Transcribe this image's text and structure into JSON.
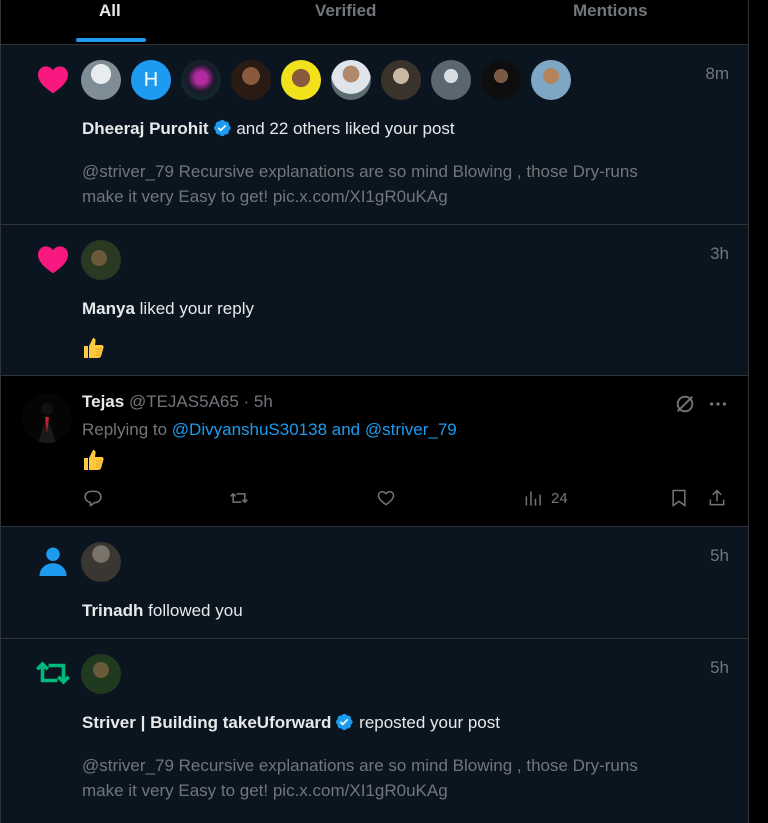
{
  "tabs": [
    {
      "label": "All",
      "active": true
    },
    {
      "label": "Verified",
      "active": false
    },
    {
      "label": "Mentions",
      "active": false
    }
  ],
  "notifications": [
    {
      "type": "like",
      "time": "8m",
      "actor": "Dheeraj Purohit",
      "verified": true,
      "action": "and 22 others liked your post",
      "preview": "@striver_79  Recursive explanations are  so mind Blowing , those Dry-runs make it very Easy to get! pic.x.com/XI1gR0uKAg",
      "avatar_letter": "H"
    },
    {
      "type": "like",
      "time": "3h",
      "actor": "Manya",
      "action": "liked your reply",
      "emoji": "thumbs-up"
    },
    {
      "type": "reply",
      "name": "Tejas",
      "handle": "@TEJAS5A65 · 5h",
      "replying_prefix": "Replying to",
      "replying_to": "@DivyanshuS30138 and @striver_79",
      "emoji": "thumbs-up",
      "views": "24"
    },
    {
      "type": "follow",
      "time": "5h",
      "actor": "Trinadh",
      "action": "followed you"
    },
    {
      "type": "repost",
      "time": "5h",
      "actor": "Striver | Building takeUforward",
      "verified": true,
      "action": "reposted your post",
      "preview": "@striver_79  Recursive explanations are  so mind Blowing , those Dry-runs make it very Easy to get! pic.x.com/XI1gR0uKAg"
    }
  ],
  "colors": {
    "accent": "#1d9bf0",
    "like": "#f91880",
    "repost": "#00ba7c",
    "background": "#000000",
    "highlight": "#0b1520"
  }
}
